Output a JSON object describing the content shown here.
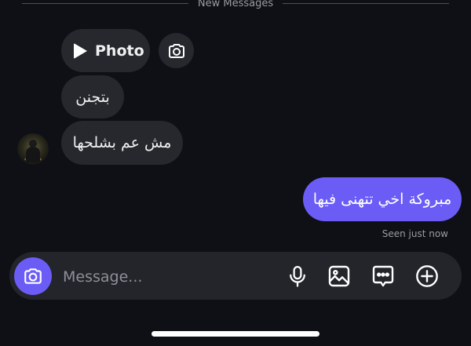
{
  "divider": {
    "label": "New Messages"
  },
  "messages": {
    "incoming": [
      {
        "type": "photo",
        "label": "Photo"
      },
      {
        "type": "text",
        "text": "بتجنن"
      },
      {
        "type": "text",
        "text": "مش عم بشلحها"
      }
    ],
    "outgoing": [
      {
        "type": "text",
        "text": "مبروكة اخي تتهنى فيها"
      }
    ],
    "seen_status": "Seen just now"
  },
  "composer": {
    "placeholder": "Message...",
    "icons": [
      "camera-icon",
      "microphone-icon",
      "gallery-icon",
      "sticker-icon",
      "plus-icon"
    ]
  },
  "colors": {
    "background": "#0e1015",
    "incoming_bubble": "#26282e",
    "outgoing_bubble": "#6b5cf6",
    "accent": "#6b5cf6"
  }
}
